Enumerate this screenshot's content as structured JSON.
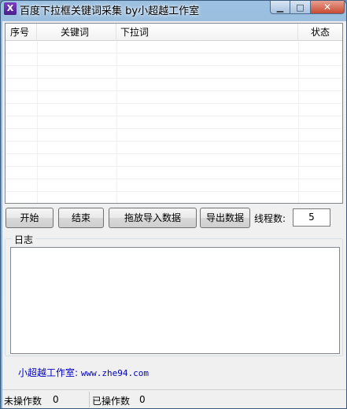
{
  "window": {
    "icon_glyph": "X",
    "title": "百度下拉框关键词采集 by小超越工作室",
    "min_glyph": "▁",
    "max_glyph": "□",
    "close_glyph": "✕"
  },
  "listview": {
    "columns": [
      "序号",
      "关键词",
      "下拉词",
      "状态"
    ],
    "rows": []
  },
  "buttons": {
    "start": "开始",
    "stop": "结束",
    "import": "拖放导入数据",
    "export": "导出数据"
  },
  "threads": {
    "label": "线程数:",
    "value": "5"
  },
  "log": {
    "title": "日志",
    "content": ""
  },
  "link": {
    "label": "小超越工作室:",
    "url": "www.zhe94.com"
  },
  "status": {
    "pending_label": "未操作数",
    "pending_value": "0",
    "done_label": "已操作数",
    "done_value": "0"
  },
  "colors": {
    "link": "#0000c0",
    "title_bar": "#8fb4d8"
  }
}
